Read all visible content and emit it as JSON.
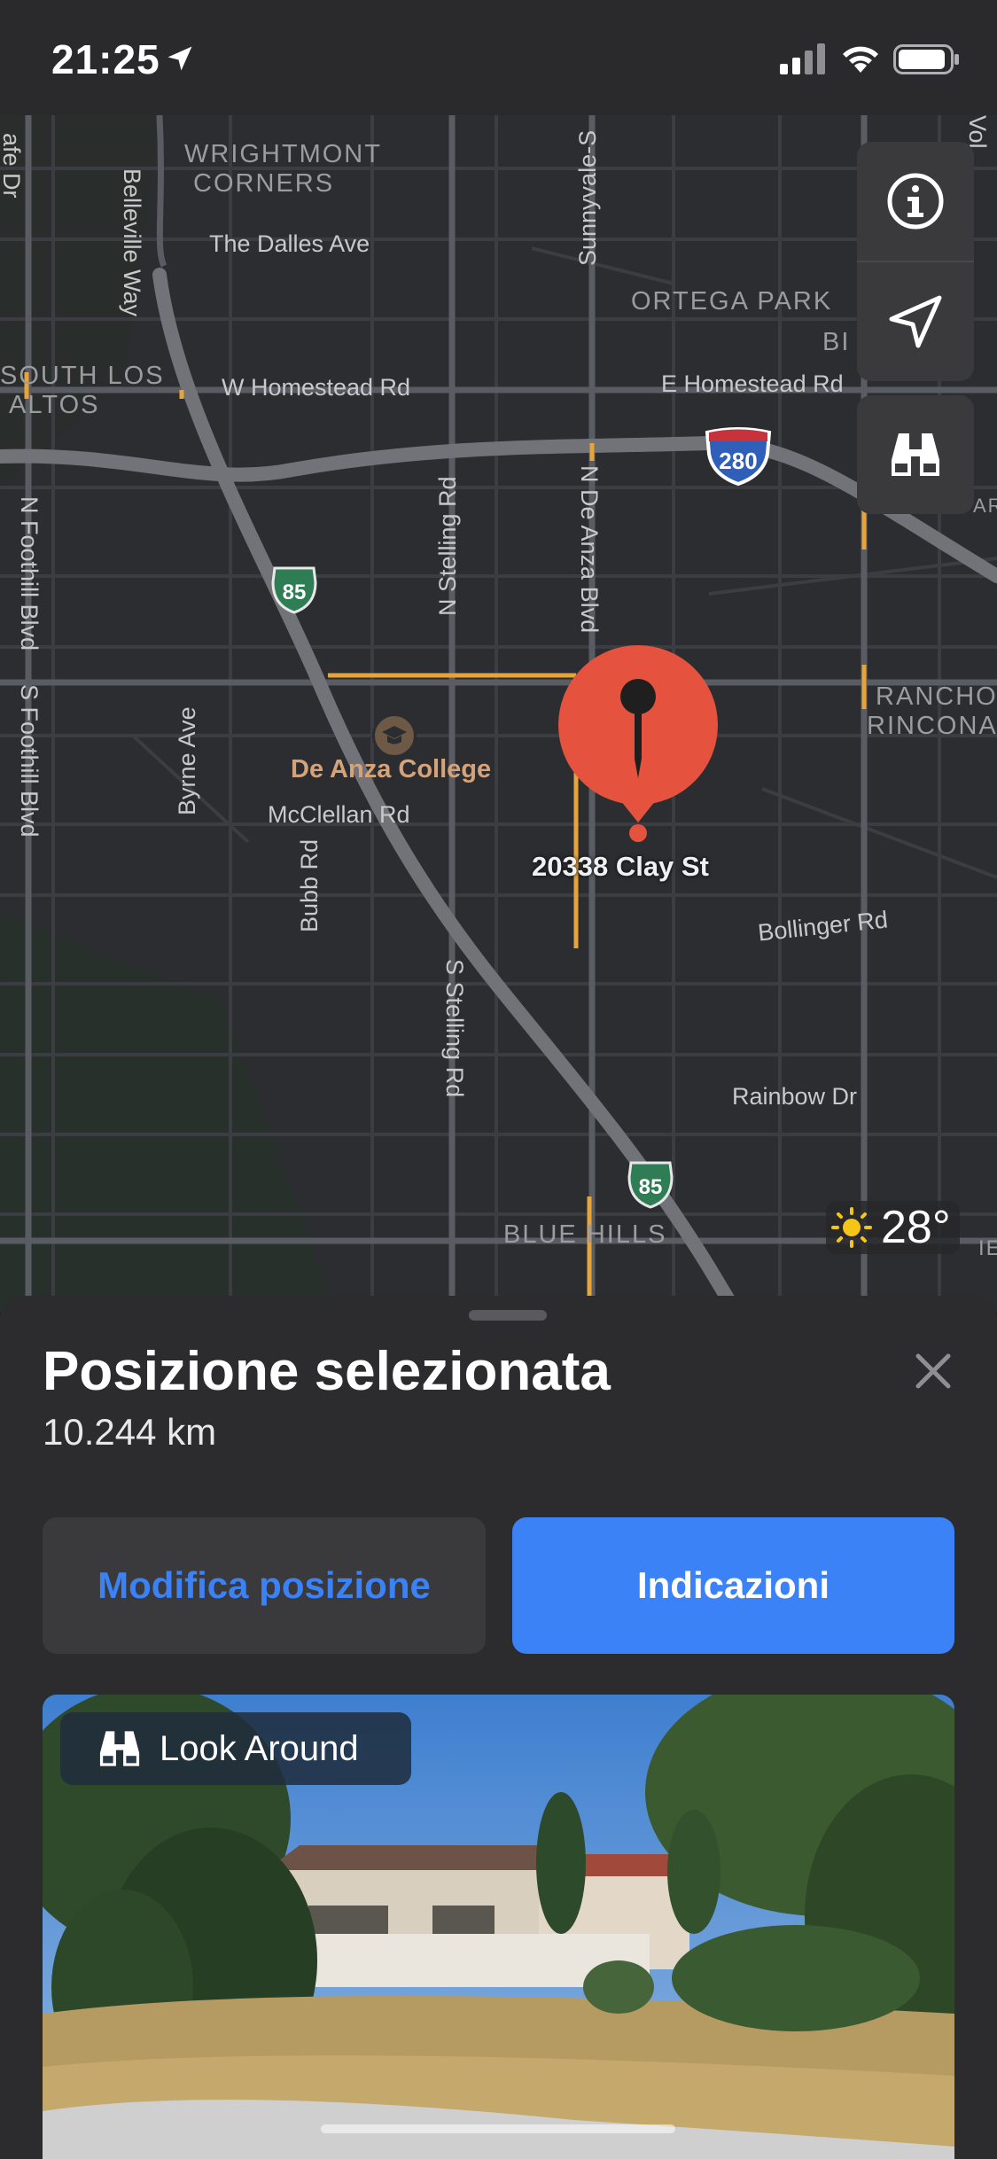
{
  "status_bar": {
    "time": "21:25"
  },
  "map": {
    "areas": {
      "wrightmont": "WRIGHTMONT\nCORNERS",
      "ortega_park": "ORTEGA PARK",
      "south_los_altos": "SOUTH LOS\nALTOS",
      "rancho_rinconada": "RANCHO\nRINCONAD",
      "blue_hills": "BLUE HILLS",
      "bi": "BI",
      "ar": "AR",
      "ie": "IE"
    },
    "streets": {
      "the_dalles": "The Dalles Ave",
      "w_homestead": "W Homestead Rd",
      "e_homestead": "E Homestead Rd",
      "belleville": "Belleville Way",
      "sunnyvale": "Sunnyvale-S",
      "n_stelling": "N Stelling Rd",
      "n_de_anza": "N De Anza Blvd",
      "n_foothill": "N Foothill Blvd",
      "s_foothill": "S Foothill Blvd",
      "byrne": "Byrne Ave",
      "mcclellan": "McClellan Rd",
      "bubb": "Bubb Rd",
      "s_stelling": "S Stelling Rd",
      "bollinger": "Bollinger Rd",
      "rainbow": "Rainbow Dr",
      "sfe_dr": "afe Dr",
      "vol": "Vol"
    },
    "shields": {
      "i280": "280",
      "ca85_top": "85",
      "ca85_bottom": "85"
    },
    "college": "De Anza College",
    "pin_label": "20338 Clay St",
    "weather_temp": "28°",
    "colors": {
      "pin": "#e5533f",
      "accent": "#3b82f6",
      "arterial": "#e6a43a"
    }
  },
  "map_controls": {
    "info_icon": "info-icon",
    "location_icon": "location-arrow-icon",
    "lookaround_icon": "binoculars-icon"
  },
  "sheet": {
    "title": "Posizione selezionata",
    "distance": "10.244 km",
    "edit_button": "Modifica posizione",
    "directions_button": "Indicazioni",
    "look_around_label": "Look Around"
  }
}
